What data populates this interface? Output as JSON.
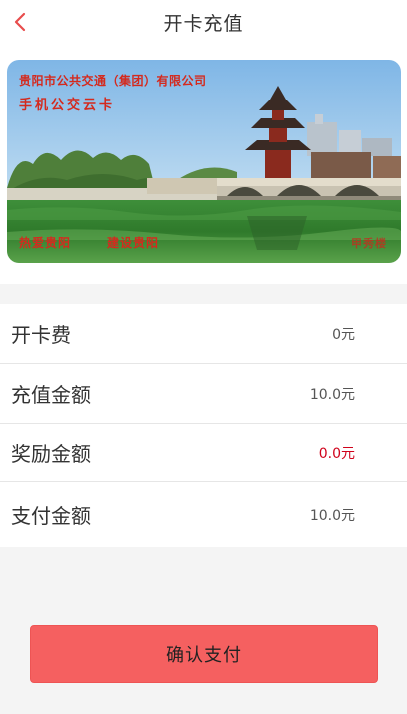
{
  "header": {
    "title": "开卡充值"
  },
  "card": {
    "company": "贵阳市公共交通（集团）有限公司",
    "card_name": "手机公交云卡",
    "slogan_1": "热爱贵阳",
    "slogan_2": "建设贵阳",
    "seal": "甲秀楼"
  },
  "rows": [
    {
      "label": "开卡费",
      "value": "0元"
    },
    {
      "label": "充值金额",
      "value": "10.0元"
    },
    {
      "label": "奖励金额",
      "value": "0.0元"
    },
    {
      "label": "支付金额",
      "value": "10.0元"
    }
  ],
  "confirm": {
    "label": "确认支付"
  },
  "colors": {
    "accent": "#f56060",
    "reward_value": "#d0021b",
    "back_arrow": "#e84c4c"
  }
}
